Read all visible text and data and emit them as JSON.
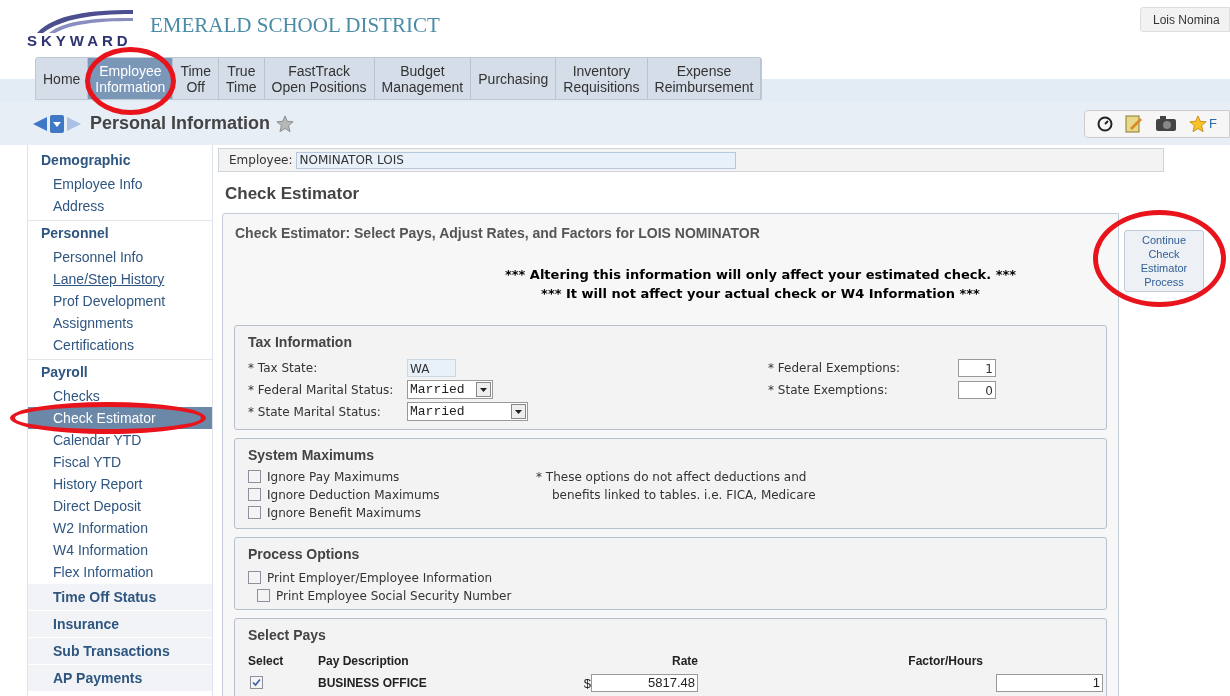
{
  "header": {
    "logo_text": "SKYWARD",
    "district": "EMERALD SCHOOL DISTRICT",
    "user": "Lois Nomina"
  },
  "nav_tabs": [
    {
      "label": "Home",
      "selected": false,
      "circled": false
    },
    {
      "label": "Employee Information",
      "selected": true,
      "circled": true
    },
    {
      "label": "Time Off",
      "selected": false,
      "circled": false
    },
    {
      "label": "True Time",
      "selected": false,
      "circled": false
    },
    {
      "label": "FastTrack Open Positions",
      "selected": false,
      "circled": false
    },
    {
      "label": "Budget Management",
      "selected": false,
      "circled": false
    },
    {
      "label": "Purchasing",
      "selected": false,
      "circled": false
    },
    {
      "label": "Inventory Requisitions",
      "selected": false,
      "circled": false
    },
    {
      "label": "Expense Reimbursement",
      "selected": false,
      "circled": false
    }
  ],
  "breadcrumb": {
    "title": "Personal Information",
    "toolbar_cut_label": "F"
  },
  "sidebar": [
    {
      "kind": "heading",
      "label": "Demographic"
    },
    {
      "kind": "link",
      "label": "Employee Info",
      "selected": false,
      "underlined": false,
      "circled": false
    },
    {
      "kind": "link",
      "label": "Address",
      "selected": false,
      "underlined": false,
      "circled": false
    },
    {
      "kind": "heading",
      "label": "Personnel"
    },
    {
      "kind": "link",
      "label": "Personnel Info",
      "selected": false,
      "underlined": false,
      "circled": false
    },
    {
      "kind": "link",
      "label": "Lane/Step History",
      "selected": false,
      "underlined": true,
      "circled": false
    },
    {
      "kind": "link",
      "label": "Prof Development",
      "selected": false,
      "underlined": false,
      "circled": false
    },
    {
      "kind": "link",
      "label": "Assignments",
      "selected": false,
      "underlined": false,
      "circled": false
    },
    {
      "kind": "link",
      "label": "Certifications",
      "selected": false,
      "underlined": false,
      "circled": false
    },
    {
      "kind": "heading",
      "label": "Payroll"
    },
    {
      "kind": "link",
      "label": "Checks",
      "selected": false,
      "underlined": false,
      "circled": false
    },
    {
      "kind": "link",
      "label": "Check Estimator",
      "selected": true,
      "underlined": false,
      "circled": true
    },
    {
      "kind": "link",
      "label": "Calendar YTD",
      "selected": false,
      "underlined": false,
      "circled": false
    },
    {
      "kind": "link",
      "label": "Fiscal YTD",
      "selected": false,
      "underlined": false,
      "circled": false
    },
    {
      "kind": "link",
      "label": "History Report",
      "selected": false,
      "underlined": false,
      "circled": false
    },
    {
      "kind": "link",
      "label": "Direct Deposit",
      "selected": false,
      "underlined": false,
      "circled": false
    },
    {
      "kind": "link",
      "label": "W2 Information",
      "selected": false,
      "underlined": false,
      "circled": false
    },
    {
      "kind": "link",
      "label": "W4 Information",
      "selected": false,
      "underlined": false,
      "circled": false
    },
    {
      "kind": "link",
      "label": "Flex Information",
      "selected": false,
      "underlined": false,
      "circled": false
    },
    {
      "kind": "collapsed",
      "label": "Time Off Status"
    },
    {
      "kind": "collapsed",
      "label": "Insurance"
    },
    {
      "kind": "collapsed",
      "label": "Sub Transactions"
    },
    {
      "kind": "collapsed",
      "label": "AP Payments"
    }
  ],
  "employee": {
    "label": "Employee:",
    "value": "NOMINATOR LOIS"
  },
  "page_title": "Check Estimator",
  "panel_title": "Check Estimator: Select Pays, Adjust Rates, and Factors for LOIS NOMINATOR",
  "warnings": [
    "*** Altering this information will only affect your estimated check. ***",
    "*** It will not affect your actual check or W4 Information ***"
  ],
  "continue_button": {
    "label": "Continue Check Estimator Process",
    "circled": true
  },
  "tax_information": {
    "title": "Tax Information",
    "left": [
      {
        "kind": "text",
        "label": "* Tax State:",
        "value": "WA"
      },
      {
        "kind": "select",
        "label": "* Federal Marital Status:",
        "value": "Married"
      },
      {
        "kind": "select",
        "label": "* State Marital Status:",
        "value": "Married"
      }
    ],
    "right": [
      {
        "label": "* Federal Exemptions:",
        "value": "1"
      },
      {
        "label": "* State Exemptions:",
        "value": "0"
      }
    ]
  },
  "system_maximums": {
    "title": "System Maximums",
    "options": [
      {
        "label": "Ignore Pay Maximums",
        "checked": false
      },
      {
        "label": "Ignore Deduction Maximums",
        "checked": false
      },
      {
        "label": "Ignore Benefit Maximums",
        "checked": false
      }
    ],
    "note": [
      "* These options do not affect deductions and",
      "benefits linked to tables. i.e. FICA, Medicare"
    ]
  },
  "process_options": {
    "title": "Process Options",
    "options": [
      {
        "label": "Print Employer/Employee Information",
        "checked": false
      },
      {
        "label": "Print Employee Social Security Number",
        "checked": false
      }
    ]
  },
  "select_pays": {
    "title": "Select Pays",
    "columns": [
      "Select",
      "Pay Description",
      "Rate",
      "Factor/Hours"
    ],
    "rows": [
      {
        "checked": true,
        "description": "BUSINESS OFFICE",
        "currency": "$",
        "rate": "5817.48",
        "factor": "1"
      }
    ]
  }
}
